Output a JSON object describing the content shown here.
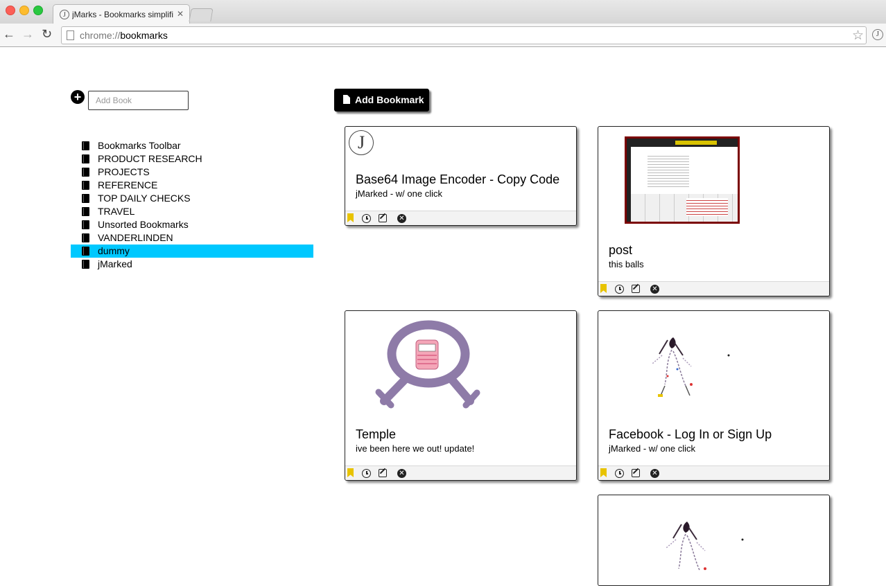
{
  "browser": {
    "tab_title": "jMarks - Bookmarks simplified",
    "tab_favicon": "J",
    "url_scheme": "chrome://",
    "url_host": "bookmarks",
    "extension_icon": "J"
  },
  "sidebar": {
    "add_book_placeholder": "Add Book",
    "books": [
      {
        "label": "Bookmarks Toolbar",
        "active": false
      },
      {
        "label": "PRODUCT RESEARCH",
        "active": false
      },
      {
        "label": "PROJECTS",
        "active": false
      },
      {
        "label": "REFERENCE",
        "active": false
      },
      {
        "label": "TOP DAILY CHECKS",
        "active": false
      },
      {
        "label": "TRAVEL",
        "active": false
      },
      {
        "label": "Unsorted Bookmarks",
        "active": false
      },
      {
        "label": "VANDERLINDEN",
        "active": false
      },
      {
        "label": "dummy",
        "active": true
      },
      {
        "label": "jMarked",
        "active": false
      }
    ],
    "active_color": "#00c8ff"
  },
  "main": {
    "add_bookmark_label": "Add Bookmark",
    "cards": [
      {
        "title": "Base64 Image Encoder - Copy Code",
        "description": "jMarked - w/ one click",
        "thumbnail": "j-logo",
        "logo_text": "J"
      },
      {
        "title": "post",
        "description": "this balls",
        "thumbnail": "webpage-screenshot"
      },
      {
        "title": "Temple",
        "description": "ive been here we out! update!",
        "thumbnail": "temple-drawing"
      },
      {
        "title": "Facebook - Log In or Sign Up",
        "description": "jMarked - w/ one click",
        "thumbnail": "dancer-drawing"
      },
      {
        "title": "",
        "description": "",
        "thumbnail": "dancer-drawing"
      }
    ],
    "footer_icons": [
      "bookmark-icon",
      "clock-icon",
      "edit-icon",
      "delete-icon"
    ],
    "bookmark_icon_color": "#e8c300"
  }
}
